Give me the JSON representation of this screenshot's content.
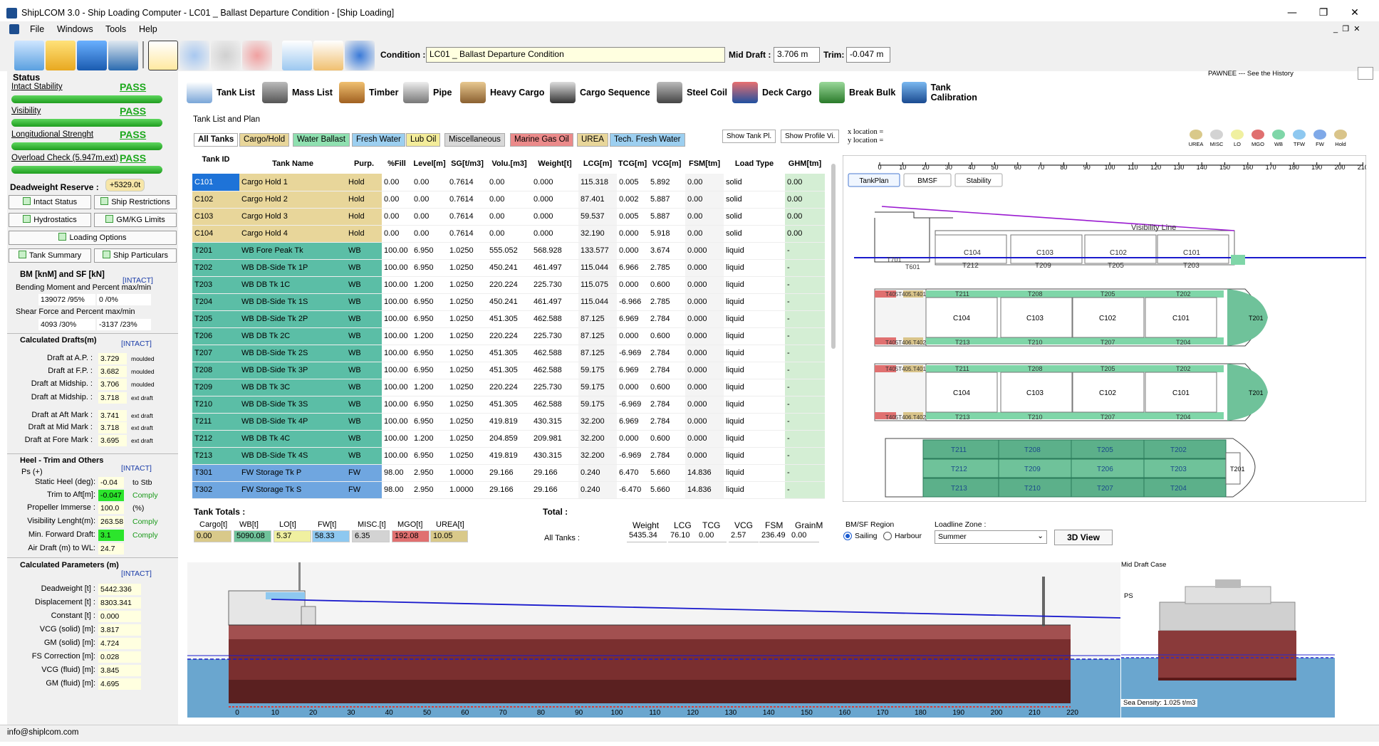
{
  "window": {
    "title": "ShipLCOM 3.0 - Ship Loading Computer - LC01 _ Ballast Departure Condition - [Ship Loading]",
    "minimize": "—",
    "maximize": "❐",
    "close": "✕"
  },
  "menu": [
    "File",
    "Windows",
    "Tools",
    "Help"
  ],
  "toolbar": {
    "condition_label": "Condition :",
    "condition_value": "LC01 _ Ballast Departure Condition",
    "mid_draft_label": "Mid Draft :",
    "mid_draft_value": "3.706 m",
    "trim_label": "Trim:",
    "trim_value": "-0.047 m",
    "history": "PAWNEE --- See the History"
  },
  "status": {
    "title": "Status",
    "items": [
      {
        "label": "Intact Stability",
        "value": "PASS"
      },
      {
        "label": "Visibility",
        "value": "PASS"
      },
      {
        "label": "Longitudional Strenght",
        "value": "PASS"
      },
      {
        "label": "Overload Check (5.947m,ext)",
        "value": "PASS"
      }
    ],
    "deadweight_label": "Deadweight Reserve :",
    "deadweight_value": "+5329.0t"
  },
  "buttons": {
    "intact_status": "Intact Status",
    "ship_restrictions": "Ship Restrictions",
    "hydrostatics": "Hydrostatics",
    "gm_kg": "GM/KG Limits",
    "loading_options": "Loading Options",
    "tank_summary": "Tank Summary",
    "ship_particulars": "Ship Particulars"
  },
  "bm": {
    "title": "BM [knM] and SF [kN]",
    "intact": "[INTACT]",
    "bending_label": "Bending Moment and Percent max/min",
    "bending_val": "139072 /95%",
    "bending_pct": "0 /0%",
    "shear_label": "Shear Force and Percent max/min",
    "shear_val": "4093 /30%",
    "shear_pct": "-3137 /23%"
  },
  "drafts": {
    "title": "Calculated Drafts(m)",
    "intact": "[INTACT]",
    "rows": [
      {
        "label": "Draft at A.P. :",
        "value": "3.729",
        "unit": "moulded"
      },
      {
        "label": "Draft at F.P. :",
        "value": "3.682",
        "unit": "moulded"
      },
      {
        "label": "Draft at Midship. :",
        "value": "3.706",
        "unit": "moulded"
      },
      {
        "label": "Draft at Midship. :",
        "value": "3.718",
        "unit": "ext draft"
      },
      {
        "label": "Draft at Aft Mark :",
        "value": "3.741",
        "unit": "ext draft"
      },
      {
        "label": "Draft at Mid Mark :",
        "value": "3.718",
        "unit": "ext draft"
      },
      {
        "label": "Draft at Fore Mark :",
        "value": "3.695",
        "unit": "ext draft"
      }
    ]
  },
  "heel": {
    "title": "Heel - Trim and Others",
    "intact": "[INTACT]",
    "ps": "Ps (+)",
    "rows": [
      {
        "label": "Static Heel (deg):",
        "value": "-0.04",
        "note": "to Stb"
      },
      {
        "label": "Trim to Aft[m]:",
        "value": "-0.047",
        "note": "Comply"
      },
      {
        "label": "Propeller Immerse :",
        "value": "100.0",
        "note": "(%)"
      },
      {
        "label": "Visibility Lenght(m):",
        "value": "263.58",
        "note": "Comply"
      },
      {
        "label": "Min. Forward Draft:",
        "value": "3.1",
        "note": "Comply"
      },
      {
        "label": "Air Draft (m) to WL:",
        "value": "24.7",
        "note": ""
      }
    ]
  },
  "params": {
    "title": "Calculated Parameters (m)",
    "intact": "[INTACT]",
    "rows": [
      {
        "label": "Deadweight [t] :",
        "value": "5442.336"
      },
      {
        "label": "Displacement [t] :",
        "value": "8303.341"
      },
      {
        "label": "Constant [t] :",
        "value": "0.000"
      },
      {
        "label": "VCG (solid) [m]:",
        "value": "3.817"
      },
      {
        "label": "GM (solid) [m]:",
        "value": "4.724"
      },
      {
        "label": "FS Correction [m]:",
        "value": "0.028"
      },
      {
        "label": "VCG (fluid) [m]:",
        "value": "3.845"
      },
      {
        "label": "GM (fluid) [m]:",
        "value": "4.695"
      }
    ]
  },
  "tabs": [
    "Tank List",
    "Mass List",
    "Timber",
    "Pipe",
    "Heavy Cargo",
    "Cargo Sequence",
    "Steel Coil",
    "Deck Cargo",
    "Break Bulk",
    "Tank Calibration"
  ],
  "tank_section": "Tank List and Plan",
  "filters": [
    "All Tanks",
    "Cargo/Hold",
    "Water Ballast",
    "Fresh Water",
    "Lub Oil",
    "Miscellaneous",
    "Marine Gas Oil",
    "UREA",
    "Tech. Fresh Water"
  ],
  "show_btns": [
    "Show Tank Pl.",
    "Show Profile Vi."
  ],
  "columns": [
    "Tank ID",
    "Tank Name",
    "Purp.",
    "%Fill",
    "Level[m]",
    "SG[t/m3]",
    "Volu.[m3]",
    "Weight[t]",
    "LCG[m]",
    "TCG[m]",
    "VCG[m]",
    "FSM[tm]",
    "Load Type",
    "GHM[tm]"
  ],
  "rows": [
    [
      "C101",
      "Cargo Hold 1",
      "Hold",
      "0.00",
      "0.00",
      "0.7614",
      "0.00",
      "0.000",
      "115.318",
      "0.005",
      "5.892",
      "0.00",
      "solid",
      "0.00"
    ],
    [
      "C102",
      "Cargo Hold 2",
      "Hold",
      "0.00",
      "0.00",
      "0.7614",
      "0.00",
      "0.000",
      "87.401",
      "0.002",
      "5.887",
      "0.00",
      "solid",
      "0.00"
    ],
    [
      "C103",
      "Cargo Hold 3",
      "Hold",
      "0.00",
      "0.00",
      "0.7614",
      "0.00",
      "0.000",
      "59.537",
      "0.005",
      "5.887",
      "0.00",
      "solid",
      "0.00"
    ],
    [
      "C104",
      "Cargo Hold 4",
      "Hold",
      "0.00",
      "0.00",
      "0.7614",
      "0.00",
      "0.000",
      "32.190",
      "0.000",
      "5.918",
      "0.00",
      "solid",
      "0.00"
    ],
    [
      "T201",
      "WB Fore Peak Tk",
      "WB",
      "100.00",
      "6.950",
      "1.0250",
      "555.052",
      "568.928",
      "133.577",
      "0.000",
      "3.674",
      "0.000",
      "liquid",
      "-"
    ],
    [
      "T202",
      "WB DB-Side Tk 1P",
      "WB",
      "100.00",
      "6.950",
      "1.0250",
      "450.241",
      "461.497",
      "115.044",
      "6.966",
      "2.785",
      "0.000",
      "liquid",
      "-"
    ],
    [
      "T203",
      "WB DB Tk 1C",
      "WB",
      "100.00",
      "1.200",
      "1.0250",
      "220.224",
      "225.730",
      "115.075",
      "0.000",
      "0.600",
      "0.000",
      "liquid",
      "-"
    ],
    [
      "T204",
      "WB DB-Side Tk 1S",
      "WB",
      "100.00",
      "6.950",
      "1.0250",
      "450.241",
      "461.497",
      "115.044",
      "-6.966",
      "2.785",
      "0.000",
      "liquid",
      "-"
    ],
    [
      "T205",
      "WB DB-Side Tk 2P",
      "WB",
      "100.00",
      "6.950",
      "1.0250",
      "451.305",
      "462.588",
      "87.125",
      "6.969",
      "2.784",
      "0.000",
      "liquid",
      "-"
    ],
    [
      "T206",
      "WB DB Tk 2C",
      "WB",
      "100.00",
      "1.200",
      "1.0250",
      "220.224",
      "225.730",
      "87.125",
      "0.000",
      "0.600",
      "0.000",
      "liquid",
      "-"
    ],
    [
      "T207",
      "WB DB-Side Tk 2S",
      "WB",
      "100.00",
      "6.950",
      "1.0250",
      "451.305",
      "462.588",
      "87.125",
      "-6.969",
      "2.784",
      "0.000",
      "liquid",
      "-"
    ],
    [
      "T208",
      "WB DB-Side Tk 3P",
      "WB",
      "100.00",
      "6.950",
      "1.0250",
      "451.305",
      "462.588",
      "59.175",
      "6.969",
      "2.784",
      "0.000",
      "liquid",
      "-"
    ],
    [
      "T209",
      "WB DB Tk 3C",
      "WB",
      "100.00",
      "1.200",
      "1.0250",
      "220.224",
      "225.730",
      "59.175",
      "0.000",
      "0.600",
      "0.000",
      "liquid",
      "-"
    ],
    [
      "T210",
      "WB DB-Side Tk 3S",
      "WB",
      "100.00",
      "6.950",
      "1.0250",
      "451.305",
      "462.588",
      "59.175",
      "-6.969",
      "2.784",
      "0.000",
      "liquid",
      "-"
    ],
    [
      "T211",
      "WB DB-Side Tk 4P",
      "WB",
      "100.00",
      "6.950",
      "1.0250",
      "419.819",
      "430.315",
      "32.200",
      "6.969",
      "2.784",
      "0.000",
      "liquid",
      "-"
    ],
    [
      "T212",
      "WB DB Tk 4C",
      "WB",
      "100.00",
      "1.200",
      "1.0250",
      "204.859",
      "209.981",
      "32.200",
      "0.000",
      "0.600",
      "0.000",
      "liquid",
      "-"
    ],
    [
      "T213",
      "WB DB-Side Tk 4S",
      "WB",
      "100.00",
      "6.950",
      "1.0250",
      "419.819",
      "430.315",
      "32.200",
      "-6.969",
      "2.784",
      "0.000",
      "liquid",
      "-"
    ],
    [
      "T301",
      "FW Storage Tk P",
      "FW",
      "98.00",
      "2.950",
      "1.0000",
      "29.166",
      "29.166",
      "0.240",
      "6.470",
      "5.660",
      "14.836",
      "liquid",
      "-"
    ],
    [
      "T302",
      "FW Storage Tk S",
      "FW",
      "98.00",
      "2.950",
      "1.0000",
      "29.166",
      "29.166",
      "0.240",
      "-6.470",
      "5.660",
      "14.836",
      "liquid",
      "-"
    ]
  ],
  "plan": {
    "x_loc": "x location =",
    "y_loc": "y location =",
    "legend": [
      "UREA",
      "MISC",
      "LO",
      "MGO",
      "WB",
      "TFW",
      "FW",
      "Hold"
    ],
    "legend_colors": [
      "#d9c98a",
      "#d3d3d3",
      "#f0f0a0",
      "#e07070",
      "#7fd6a8",
      "#8ec8f0",
      "#7fa9e8",
      "#d9c48a"
    ],
    "ruler": [
      "0",
      "10",
      "20",
      "30",
      "40",
      "50",
      "60",
      "70",
      "80",
      "90",
      "100",
      "110",
      "120",
      "130",
      "140",
      "150",
      "160",
      "170",
      "180",
      "190",
      "200",
      "210"
    ],
    "buttons": [
      "TankPlan",
      "BMSF",
      "Stability"
    ],
    "visibility": "Visibility Line",
    "holds": [
      "C104",
      "C103",
      "C102",
      "C101"
    ],
    "tanks_top": [
      "T212",
      "T209",
      "T205",
      "T203"
    ],
    "profile_aft": [
      "T701",
      "T601"
    ],
    "deck2_top": [
      "T211",
      "T208",
      "T205",
      "T202"
    ],
    "deck2_bot": [
      "T213",
      "T210",
      "T207",
      "T204"
    ],
    "deck_aft_labels": [
      "T405T405.T401",
      "T301",
      "T302",
      "T405T406.T402"
    ],
    "plan_fwd": "T201",
    "db_rows": [
      [
        "T211",
        "T208",
        "T205",
        "T202"
      ],
      [
        "T212",
        "T209",
        "T206",
        "T203"
      ],
      [
        "T213",
        "T210",
        "T207",
        "T204"
      ]
    ]
  },
  "totals": {
    "title": "Tank Totals :",
    "labels": [
      "Cargo[t]",
      "WB[t]",
      "LO[t]",
      "FW[t]",
      "MISC.[t]",
      "MGO[t]",
      "UREA[t]"
    ],
    "values": [
      "0.00",
      "5090.08",
      "5.37",
      "58.33",
      "6.35",
      "192.08",
      "10.05"
    ],
    "colors": [
      "#d9c98a",
      "#6fc29a",
      "#f0f0a0",
      "#8ec8f0",
      "#d3d3d3",
      "#e07070",
      "#d9c98a"
    ],
    "total_title": "Total :",
    "all_tanks": "All Tanks :",
    "total_labels": [
      "Weight",
      "LCG",
      "TCG",
      "VCG",
      "FSM",
      "GrainM"
    ],
    "total_values": [
      "5435.34",
      "76.10",
      "0.00",
      "2.57",
      "236.49",
      "0.00"
    ],
    "bmsf_region": "BM/SF Region",
    "sailing": "Sailing",
    "harbour": "Harbour",
    "loadline": "Loadline Zone :",
    "loadline_value": "Summer",
    "view3d": "3D View"
  },
  "profile": {
    "ticks": [
      "0",
      "10",
      "20",
      "30",
      "40",
      "50",
      "60",
      "70",
      "80",
      "90",
      "100",
      "110",
      "120",
      "130",
      "140",
      "150",
      "160",
      "170",
      "180",
      "190",
      "200",
      "210",
      "220"
    ],
    "midcase": "Mid Draft Case",
    "ps": "PS",
    "sea_density": "Sea Density: 1.025 t/m3"
  },
  "statusbar": "info@shiplcom.com"
}
